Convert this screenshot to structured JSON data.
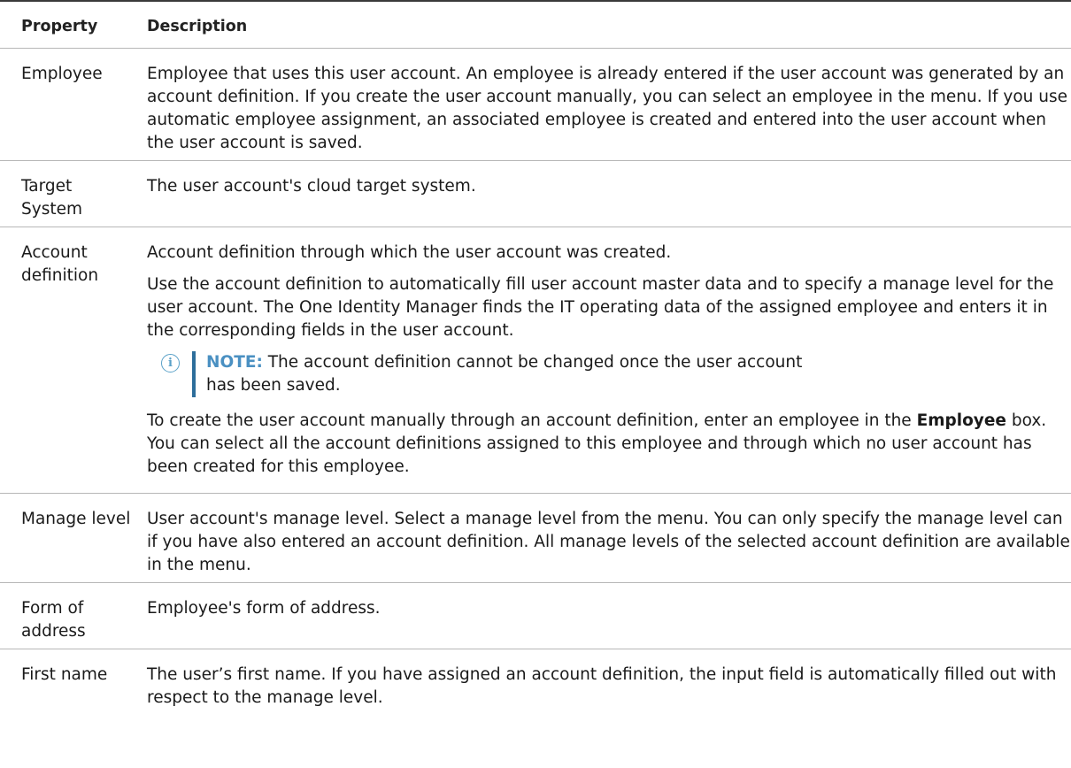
{
  "table": {
    "header": {
      "property": "Property",
      "description": "Description"
    },
    "rows": [
      {
        "property": "Employee",
        "description": "Employee that uses this user account. An employee is already entered if the user account was generated by an account definition. If you create the user account manually, you can select an employee in the menu. If you use automatic employee assignment, an associated employee is created and entered into the user account when the user account is saved."
      },
      {
        "property": "Target System",
        "description": "The user account's cloud target system."
      },
      {
        "property": "Account definition",
        "description_1": "Account definition through which the user account was created.",
        "description_2": "Use the account definition to automatically fill user account master data and to specify a manage level for the user account. The One Identity Manager finds the IT operating data of the assigned employee and enters it in the corresponding fields in the user account.",
        "note_label": "NOTE:",
        "note_text": " The account definition cannot be changed once the user account has been saved.",
        "description_3a": "To create the user account manually through an account definition, enter an employee in the ",
        "description_3_bold": "Employee",
        "description_3b": " box. You can select all the account definitions assigned to this employee and through which no user account has been created for this employee."
      },
      {
        "property": "Manage level",
        "description": "User account's manage level. Select a manage level from the menu. You can only specify the manage level can if you have also entered an account definition. All manage levels of the selected account definition are available in the menu."
      },
      {
        "property": "Form of address",
        "description": "Employee's form of address."
      },
      {
        "property": "First name",
        "description": "The user’s first name. If you have assigned an account definition, the input field is automatically filled out with respect to the manage level."
      }
    ]
  },
  "icons": {
    "note_icon": "info-circle-icon",
    "note_glyph": "i",
    "accent_color": "#4a90c2"
  }
}
